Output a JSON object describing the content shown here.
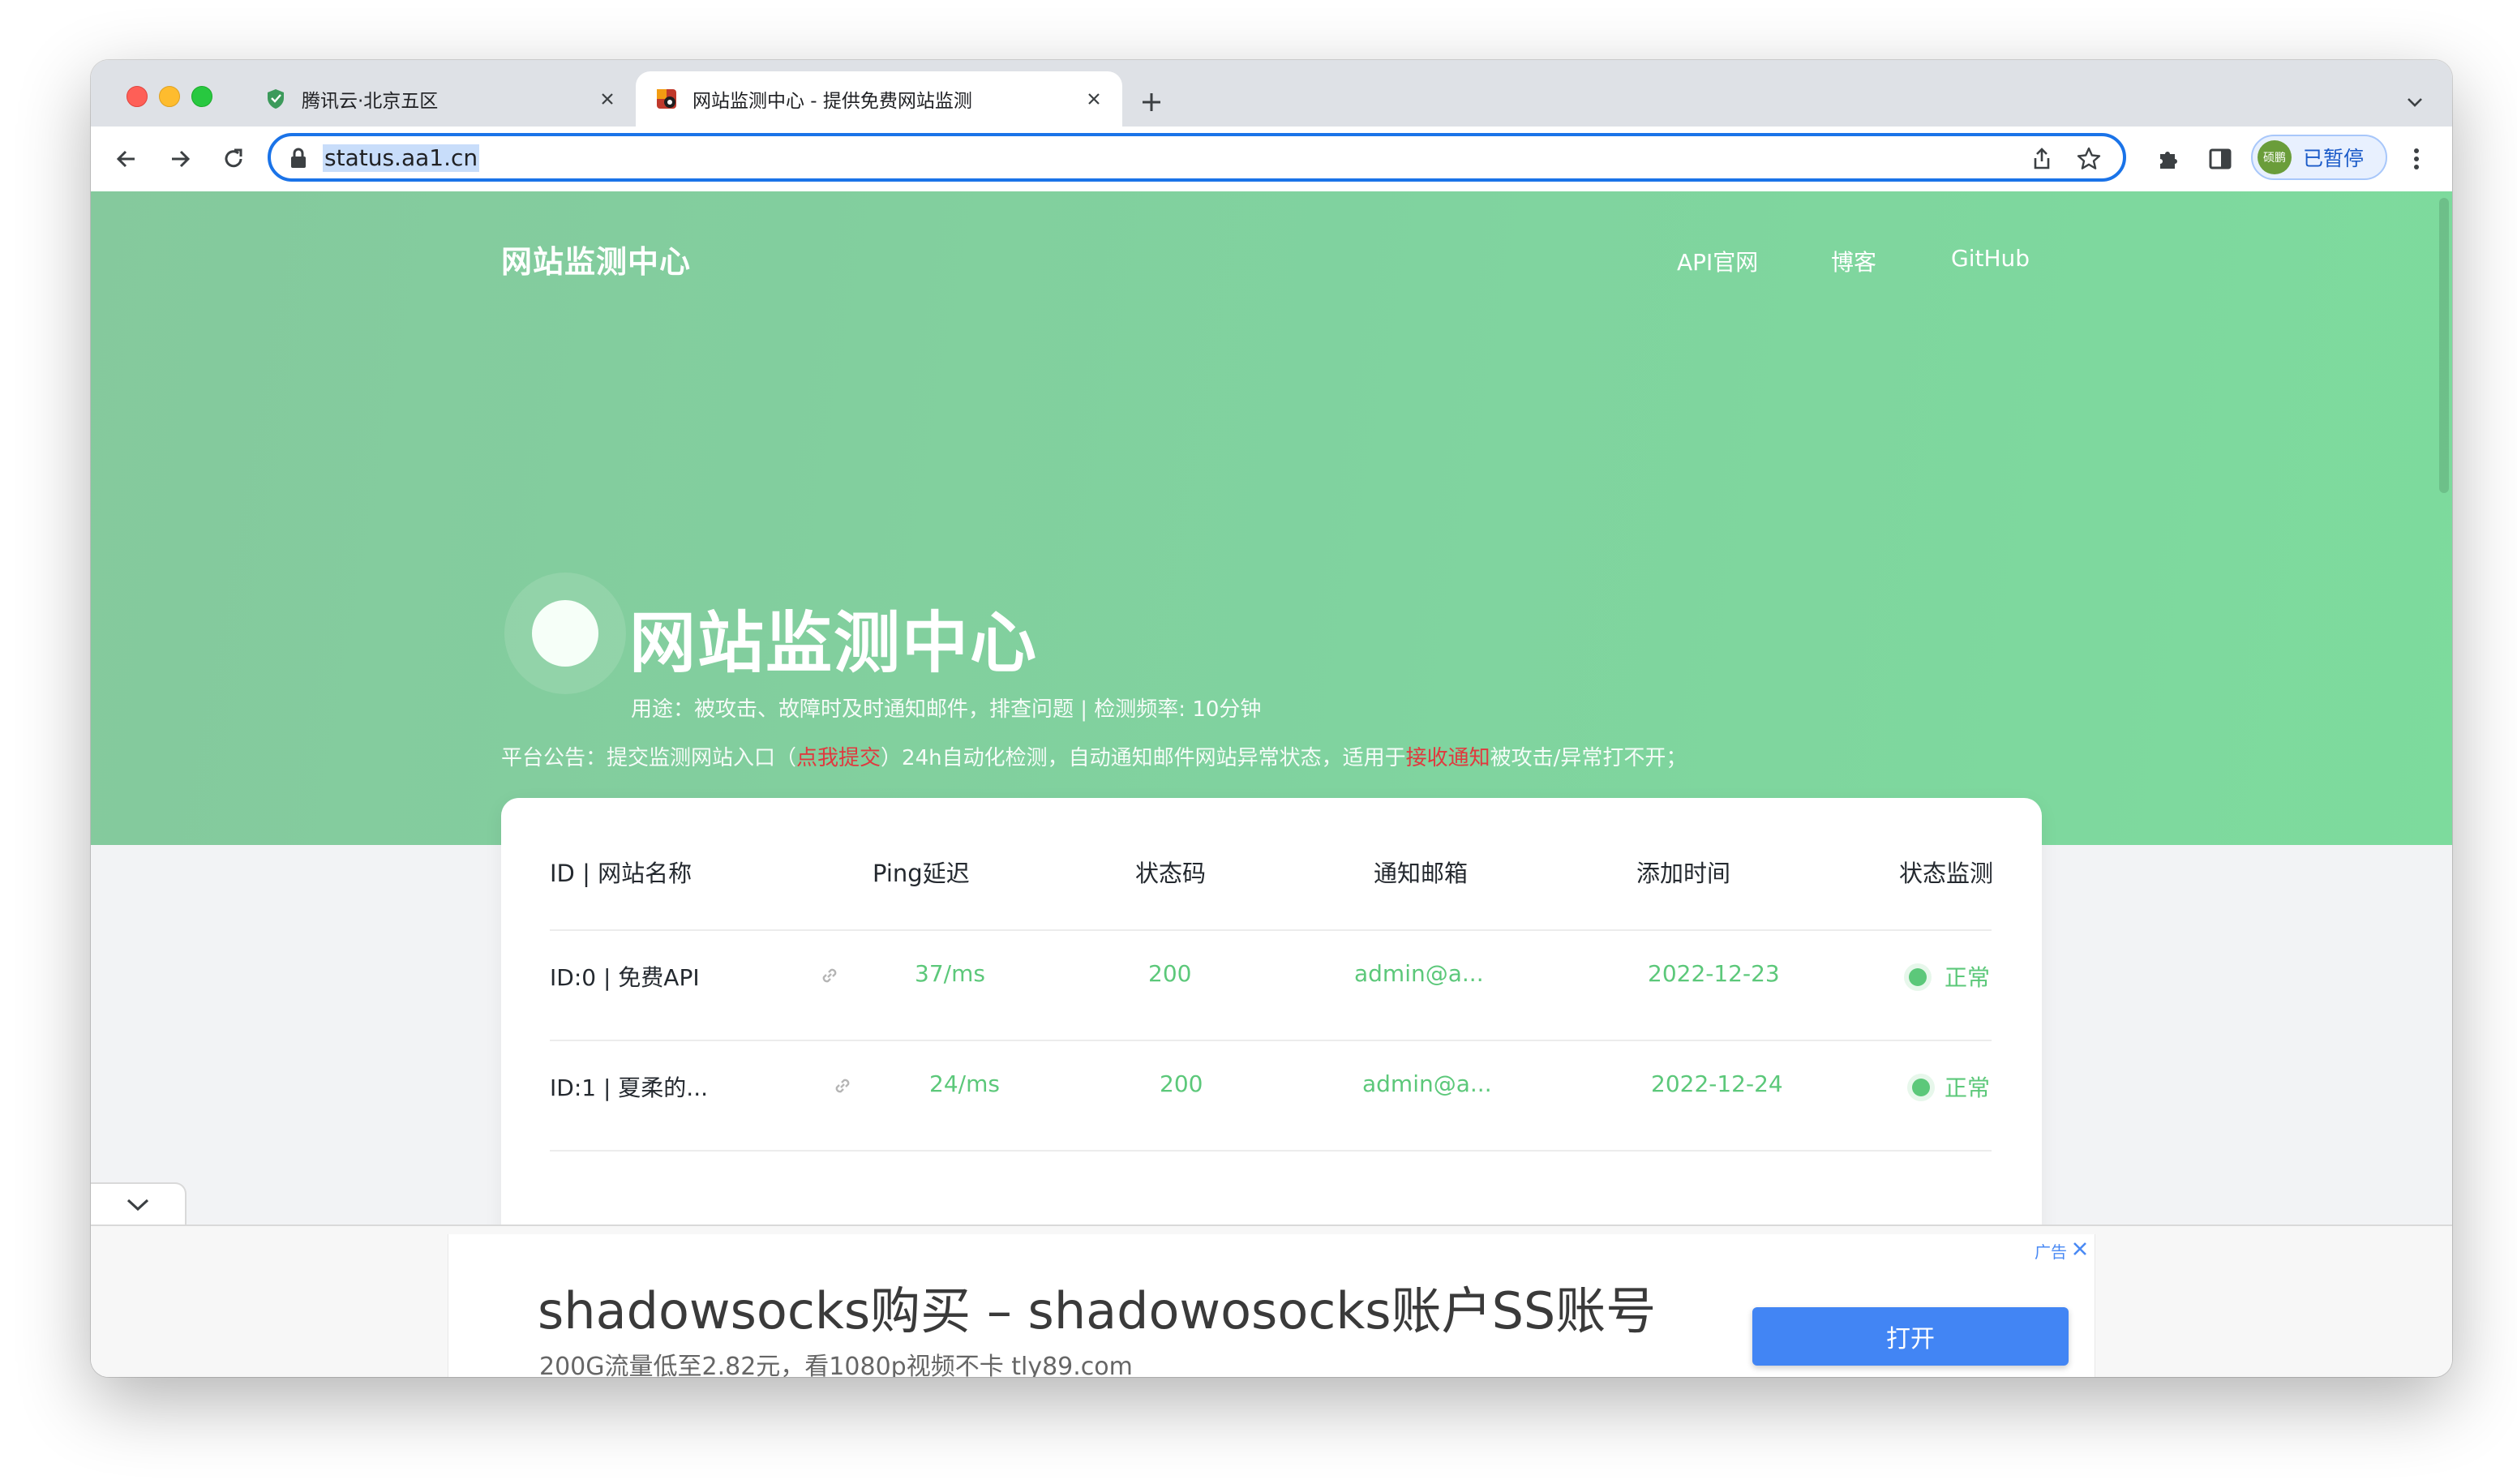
{
  "browser": {
    "tabs": [
      {
        "title": "腾讯云·北京五区",
        "active": false,
        "favicon": "green-shield-icon"
      },
      {
        "title": "网站监测中心 - 提供免费网站监测",
        "active": true,
        "favicon": "camera-site-icon"
      }
    ],
    "url": "status.aa1.cn",
    "profile_avatar_text": "硕鹏",
    "profile_status": "已暂停"
  },
  "site": {
    "brand": "网站监测中心",
    "nav": [
      {
        "label": "API官网"
      },
      {
        "label": "博客"
      },
      {
        "label": "GitHub"
      }
    ],
    "hero": {
      "title": "网站监测中心",
      "subtitle": "用途：被攻击、故障时及时通知邮件，排查问题 | 检测频率: 10分钟"
    },
    "notice": {
      "prefix": "平台公告：提交监测网站入口（",
      "link_submit": "点我提交",
      "middle": "）24h自动化检测，自动通知邮件网站异常状态，适用于",
      "link_receive": "接收通知",
      "suffix": "被攻击/异常打不开；"
    }
  },
  "table": {
    "headers": [
      "ID | 网站名称",
      "Ping延迟",
      "状态码",
      "通知邮箱",
      "添加时间",
      "状态监测"
    ],
    "rows": [
      {
        "name": "ID:0 | 免费API",
        "ping": "37/ms",
        "code": "200",
        "email": "admin@a...",
        "date": "2022-12-23",
        "status": "正常"
      },
      {
        "name": "ID:1 | 夏柔的...",
        "ping": "24/ms",
        "code": "200",
        "email": "admin@a...",
        "date": "2022-12-24",
        "status": "正常"
      }
    ]
  },
  "ad": {
    "label": "广告",
    "title": "shadowsocks购买 – shadowosocks账户SS账号",
    "description": "200G流量低至2.82元，看1080p视频不卡 tly89.com",
    "button": "打开"
  },
  "colors": {
    "hero_green": "#80d39f",
    "status_green": "#5cc87a",
    "notice_red": "#e0393e",
    "ad_button_blue": "#4285f4",
    "omnibox_focus": "#1a73e8"
  }
}
